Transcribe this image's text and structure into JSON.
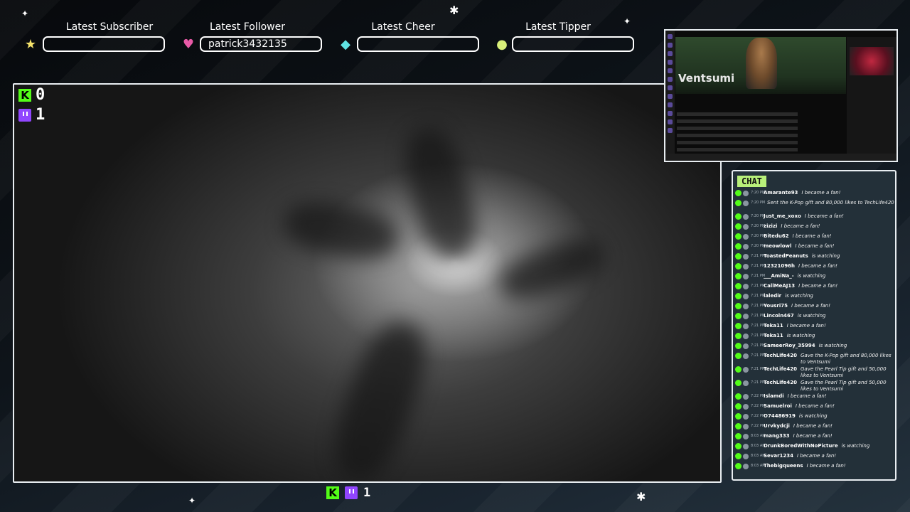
{
  "latest": [
    {
      "label": "Latest Subscriber",
      "value": "",
      "icon": "star-icon",
      "color": "#f4e26b"
    },
    {
      "label": "Latest Follower",
      "value": "patrick3432135",
      "icon": "heart-icon",
      "color": "#e85aa7"
    },
    {
      "label": "Latest Cheer",
      "value": "",
      "icon": "diamond-icon",
      "color": "#5fe3e3"
    },
    {
      "label": "Latest Tipper",
      "value": "",
      "icon": "coin-icon",
      "color": "#d9f07a"
    }
  ],
  "counters": {
    "kick_icon_glyph": "K",
    "kick_count": "0",
    "twitch_count": "1",
    "bottom_count": "1"
  },
  "preview": {
    "channel_name": "Ventsumi"
  },
  "chat": {
    "title": "CHAT",
    "messages": [
      {
        "time": "7:20 PM",
        "user": "Amarante93",
        "text": "I became a fan!"
      },
      {
        "time": "7:20 PM",
        "user": "",
        "text": "Sent the K-Pop gift and 80,000 likes to TechLife420"
      },
      {
        "time": "7:20 PM",
        "user": "Just_me_xoxo",
        "text": "I became a fan!"
      },
      {
        "time": "7:20 PM",
        "user": "zizizi",
        "text": "I became a fan!"
      },
      {
        "time": "7:20 PM",
        "user": "Bitedu62",
        "text": "I became a fan!"
      },
      {
        "time": "7:20 PM",
        "user": "meowlowl",
        "text": "I became a fan!"
      },
      {
        "time": "7:21 PM",
        "user": "ToastedPeanuts",
        "text": "is watching"
      },
      {
        "time": "7:21 PM",
        "user": "12321096h",
        "text": "I became a fan!"
      },
      {
        "time": "7:21 PM",
        "user": "___AmiNa_-",
        "text": "is watching"
      },
      {
        "time": "7:21 PM",
        "user": "CallMeAJ13",
        "text": "I became a fan!"
      },
      {
        "time": "7:21 PM",
        "user": "laledir",
        "text": "is watching"
      },
      {
        "time": "7:21 PM",
        "user": "Yousri75",
        "text": "I became a fan!"
      },
      {
        "time": "7:21 PM",
        "user": "Lincoln467",
        "text": "is watching"
      },
      {
        "time": "7:21 PM",
        "user": "Teka11",
        "text": "I became a fan!"
      },
      {
        "time": "7:21 PM",
        "user": "Teka11",
        "text": "is watching"
      },
      {
        "time": "7:21 PM",
        "user": "SameerRoy_35994",
        "text": "is watching"
      },
      {
        "time": "7:21 PM",
        "user": "TechLife420",
        "text": "Gave the K-Pop gift and 80,000 likes to Ventsumi"
      },
      {
        "time": "7:21 PM",
        "user": "TechLife420",
        "text": "Gave the Pearl Tip gift and 50,000 likes to Ventsumi"
      },
      {
        "time": "7:21 PM",
        "user": "TechLife420",
        "text": "Gave the Pearl Tip gift and 50,000 likes to Ventsumi"
      },
      {
        "time": "7:22 PM",
        "user": "Islamdi",
        "text": "I became a fan!"
      },
      {
        "time": "7:22 PM",
        "user": "Samuelroi",
        "text": "I became a fan!"
      },
      {
        "time": "7:22 PM",
        "user": "O74486919",
        "text": "is watching"
      },
      {
        "time": "7:22 PM",
        "user": "Urvkydcji",
        "text": "I became a fan!"
      },
      {
        "time": "8:03 AM",
        "user": "mang333",
        "text": "I became a fan!"
      },
      {
        "time": "8:03 AM",
        "user": "DrunkBoredWithNoPicture",
        "text": "is watching"
      },
      {
        "time": "8:03 AM",
        "user": "Sevar1234",
        "text": "I became a fan!"
      },
      {
        "time": "8:03 AM",
        "user": "Thebigqueens",
        "text": "I became a fan!"
      }
    ]
  },
  "colors": {
    "kick": "#53fc18",
    "twitch": "#9146ff",
    "chat_tab": "#b8f07a",
    "chat_bg": "#233039"
  }
}
